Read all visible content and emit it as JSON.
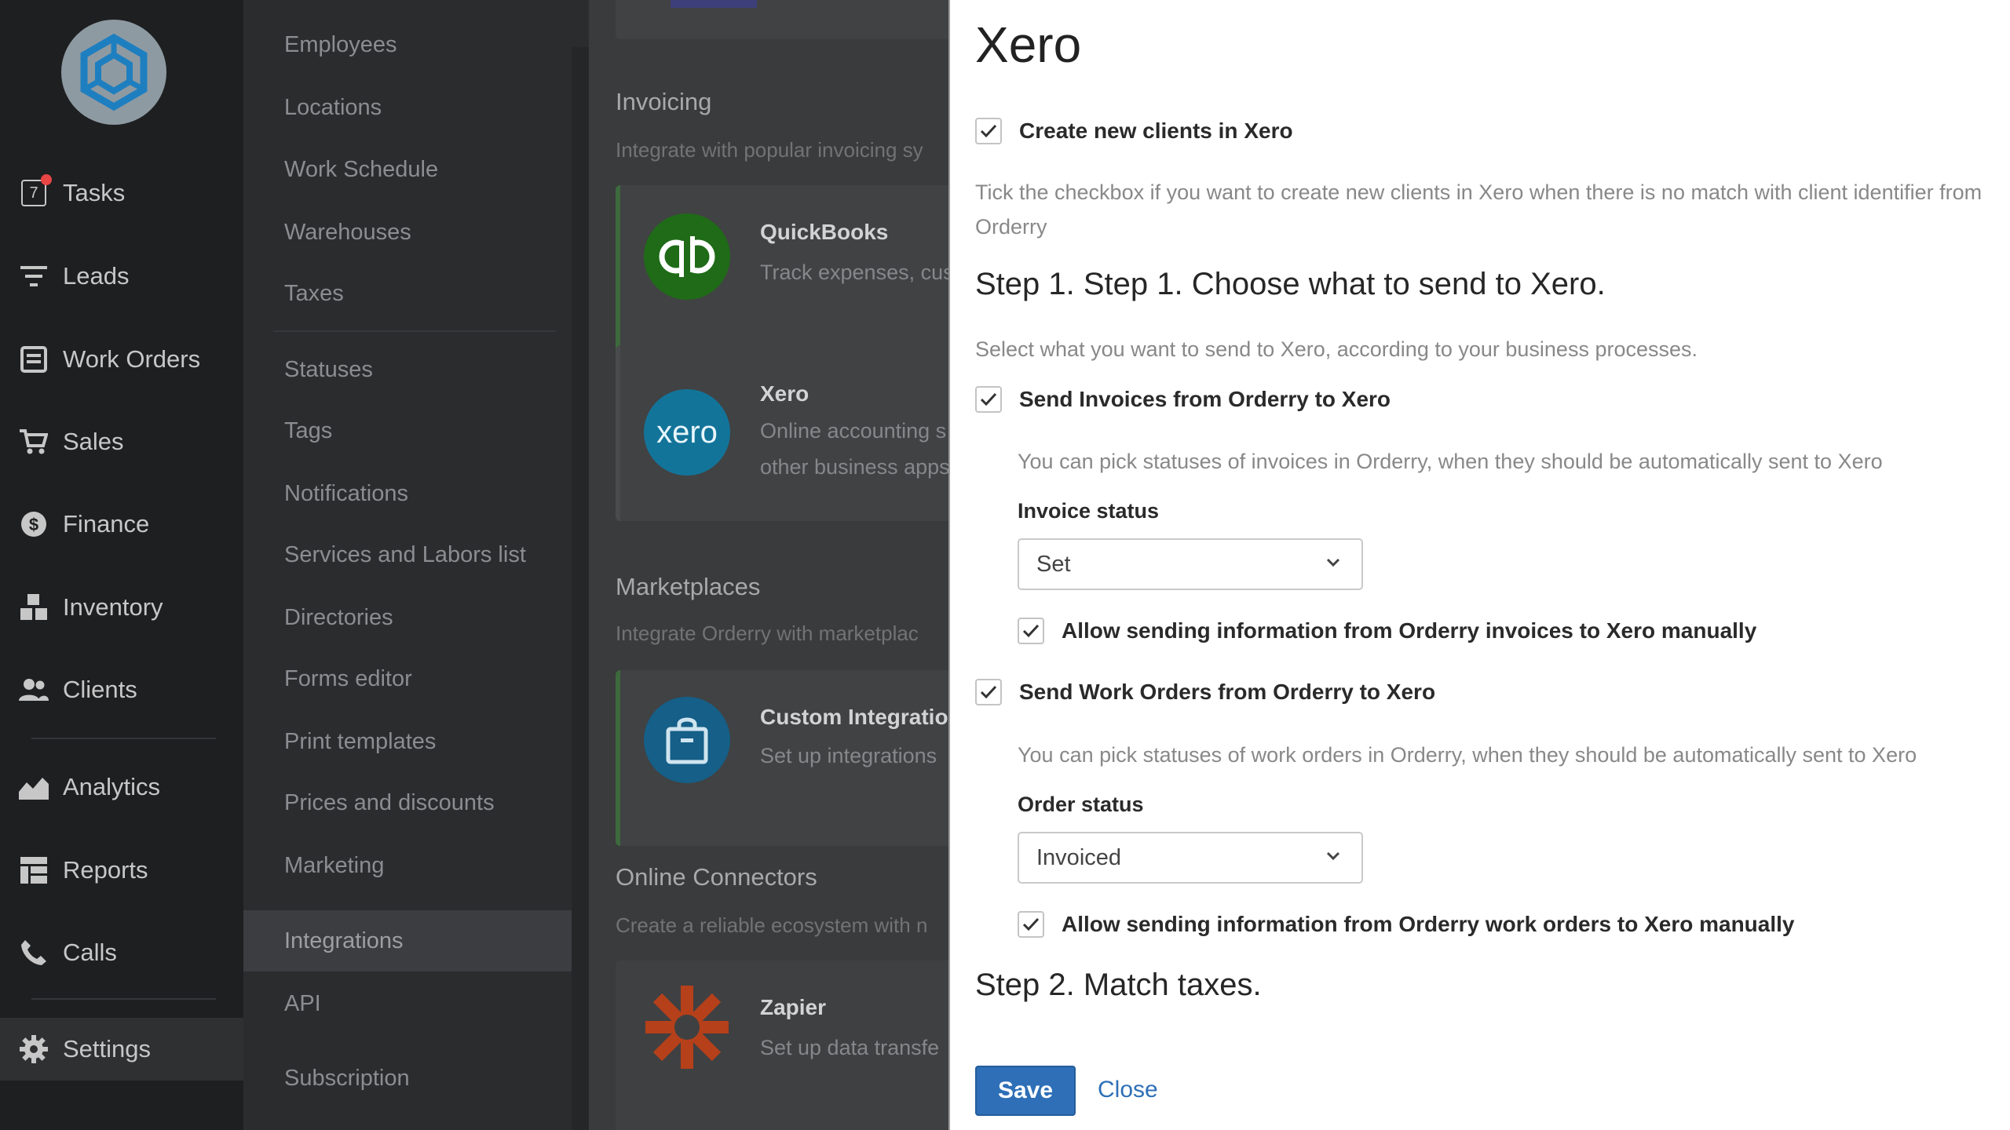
{
  "nav": {
    "items": [
      {
        "label": "Tasks",
        "icon": "tasks-icon",
        "badge": "7"
      },
      {
        "label": "Leads",
        "icon": "filter-icon"
      },
      {
        "label": "Work Orders",
        "icon": "work-orders-icon"
      },
      {
        "label": "Sales",
        "icon": "cart-icon"
      },
      {
        "label": "Finance",
        "icon": "dollar-icon"
      },
      {
        "label": "Inventory",
        "icon": "boxes-icon"
      },
      {
        "label": "Clients",
        "icon": "users-icon"
      },
      {
        "label": "Analytics",
        "icon": "chart-icon"
      },
      {
        "label": "Reports",
        "icon": "reports-icon"
      },
      {
        "label": "Calls",
        "icon": "phone-icon"
      },
      {
        "label": "Settings",
        "icon": "gear-icon",
        "active": true
      }
    ]
  },
  "submenu": {
    "items": [
      "Employees",
      "Locations",
      "Work Schedule",
      "Warehouses",
      "Taxes",
      "Statuses",
      "Tags",
      "Notifications",
      "Services and Labors list",
      "Directories",
      "Forms editor",
      "Print templates",
      "Prices and discounts",
      "Marketing",
      "Integrations",
      "API",
      "Subscription"
    ],
    "active": "Integrations"
  },
  "integrations": {
    "invoicing": {
      "title": "Invoicing",
      "desc": "Integrate with popular invoicing sy"
    },
    "quickbooks": {
      "name": "QuickBooks",
      "desc": "Track expenses, cus"
    },
    "xero": {
      "name": "Xero",
      "desc1": "Online accounting s",
      "desc2": "other business apps",
      "logo_text": "xero"
    },
    "marketplaces": {
      "title": "Marketplaces",
      "desc": "Integrate Orderry with marketplac"
    },
    "custom": {
      "name": "Custom Integratio",
      "desc": "Set up integrations"
    },
    "connectors": {
      "title": "Online Connectors",
      "desc": "Create a reliable ecosystem with n"
    },
    "zapier": {
      "name": "Zapier",
      "desc": "Set up data transfe"
    }
  },
  "panel": {
    "title": "Xero",
    "create_clients": {
      "label": "Create new clients in Xero",
      "checked": true
    },
    "create_clients_help": "Tick the checkbox if you want to create new clients in Xero when there is no match with client identifier from Orderry",
    "step1_title": "Step 1. Step 1. Choose what to send to Xero.",
    "step1_desc": "Select what you want to send to Xero, according to your business processes.",
    "send_invoices": {
      "label": "Send Invoices from Orderry to Xero",
      "checked": true
    },
    "invoices_help": "You can pick statuses of invoices in Orderry, when they should be automatically sent to Xero",
    "invoice_status_label": "Invoice status",
    "invoice_status_value": "Set",
    "allow_invoices": {
      "label": "Allow sending information from Orderry invoices to Xero manually",
      "checked": true
    },
    "send_work_orders": {
      "label": "Send Work Orders from Orderry to Xero",
      "checked": true
    },
    "work_orders_help": "You can pick statuses of work orders in Orderry, when they should be automatically sent to Xero",
    "order_status_label": "Order status",
    "order_status_value": "Invoiced",
    "allow_work_orders": {
      "label": "Allow sending information from Orderry work orders to Xero manually",
      "checked": true
    },
    "step2_title": "Step 2. Match taxes.",
    "save_label": "Save",
    "close_label": "Close"
  },
  "colors": {
    "accent": "#2e6fb7",
    "nav_bg": "#1e1f21",
    "quickbooks": "#2ca01c",
    "xero": "#13b5ea",
    "zapier": "#ff4a00"
  }
}
